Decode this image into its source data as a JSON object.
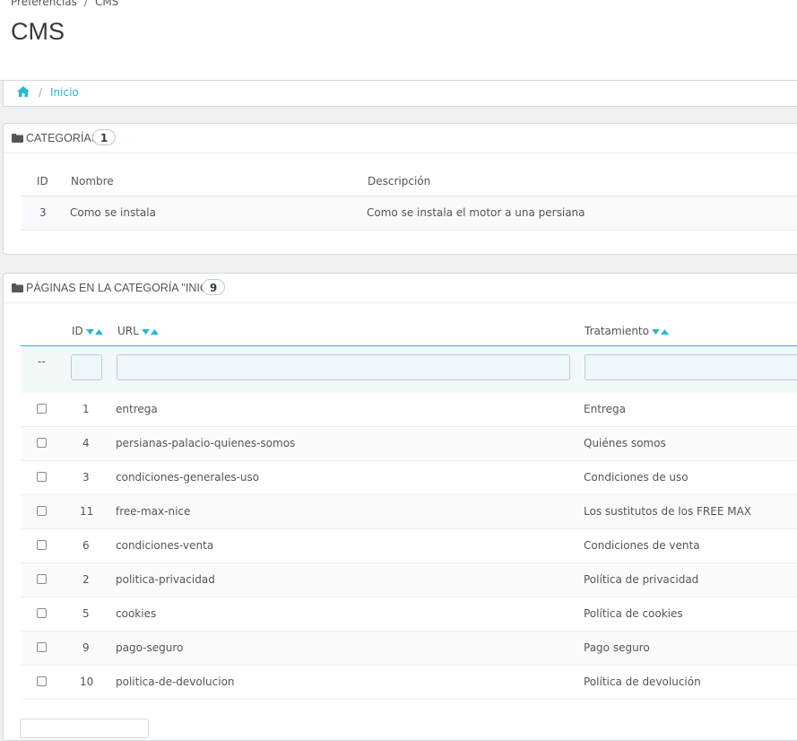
{
  "header": {
    "breadcrumb": [
      "Preferencias",
      "CMS"
    ],
    "breadcrumb_sep": "/",
    "title": "CMS"
  },
  "nav": {
    "home_icon": "home-icon",
    "separator": "/",
    "link": "Inicio"
  },
  "categories": {
    "title": "CATEGORÍAS",
    "count": "1",
    "columns": {
      "id": "ID",
      "name": "Nombre",
      "description": "Descripción"
    },
    "rows": [
      {
        "id": "3",
        "name": "Como se instala",
        "description": "Como se instala el motor a una persiana"
      }
    ]
  },
  "pages": {
    "title": "PÁGINAS EN LA CATEGORÍA \"INICIO\"",
    "count": "9",
    "columns": {
      "id": "ID",
      "url": "URL",
      "treatment": "Tratamiento"
    },
    "filter_placeholder": "--",
    "rows": [
      {
        "id": "1",
        "url": "entrega",
        "treatment": "Entrega"
      },
      {
        "id": "4",
        "url": "persianas-palacio-quienes-somos",
        "treatment": "Quiénes somos"
      },
      {
        "id": "3",
        "url": "condiciones-generales-uso",
        "treatment": "Condiciones de uso"
      },
      {
        "id": "11",
        "url": "free-max-nice",
        "treatment": "Los sustitutos de los FREE MAX"
      },
      {
        "id": "6",
        "url": "condiciones-venta",
        "treatment": "Condiciones de venta"
      },
      {
        "id": "2",
        "url": "politica-privacidad",
        "treatment": "Política de privacidad"
      },
      {
        "id": "5",
        "url": "cookies",
        "treatment": "Política de cookies"
      },
      {
        "id": "9",
        "url": "pago-seguro",
        "treatment": "Pago seguro"
      },
      {
        "id": "10",
        "url": "politica-de-devolucion",
        "treatment": "Política de devolución"
      }
    ]
  },
  "colors": {
    "accent": "#25b9d7",
    "text": "#555555",
    "title": "#363a41"
  }
}
